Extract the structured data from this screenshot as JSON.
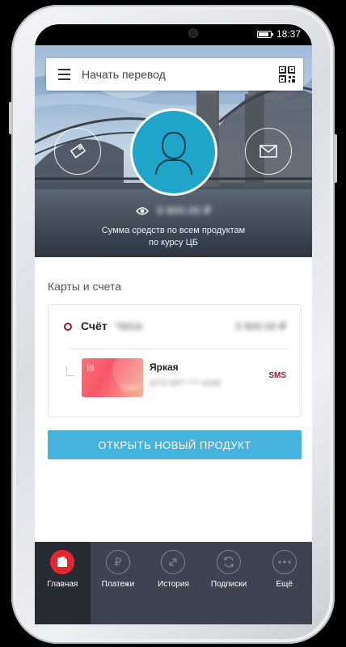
{
  "status": {
    "time": "18:37"
  },
  "header": {
    "search_placeholder": "Начать перевод"
  },
  "hero": {
    "balance_hidden": "9 800.00 ₽",
    "caption_line1": "Сумма средств по всем продуктам",
    "caption_line2": "по курсу ЦБ"
  },
  "accounts": {
    "section_title": "Карты и счета",
    "account": {
      "label": "Счёт",
      "number_hidden": "*9916",
      "balance_hidden": "0 800.00 ₽"
    },
    "card": {
      "name": "Яркая",
      "number_hidden": "5272 69** **** 6439",
      "last_digits_hidden": "*6439",
      "sms_label": "SMS"
    }
  },
  "cta": {
    "label": "ОТКРЫТЬ НОВЫЙ ПРОДУКТ"
  },
  "tabs": [
    {
      "label": "Главная",
      "icon": "home-icon"
    },
    {
      "label": "Платежи",
      "icon": "ruble-icon"
    },
    {
      "label": "История",
      "icon": "history-icon"
    },
    {
      "label": "Подписки",
      "icon": "subscriptions-icon"
    },
    {
      "label": "Ещё",
      "icon": "more-icon"
    }
  ],
  "colors": {
    "accent": "#45b3dd",
    "brand": "#e3262f",
    "avatar": "#1ea5c9",
    "tabbar": "#3d4350"
  }
}
